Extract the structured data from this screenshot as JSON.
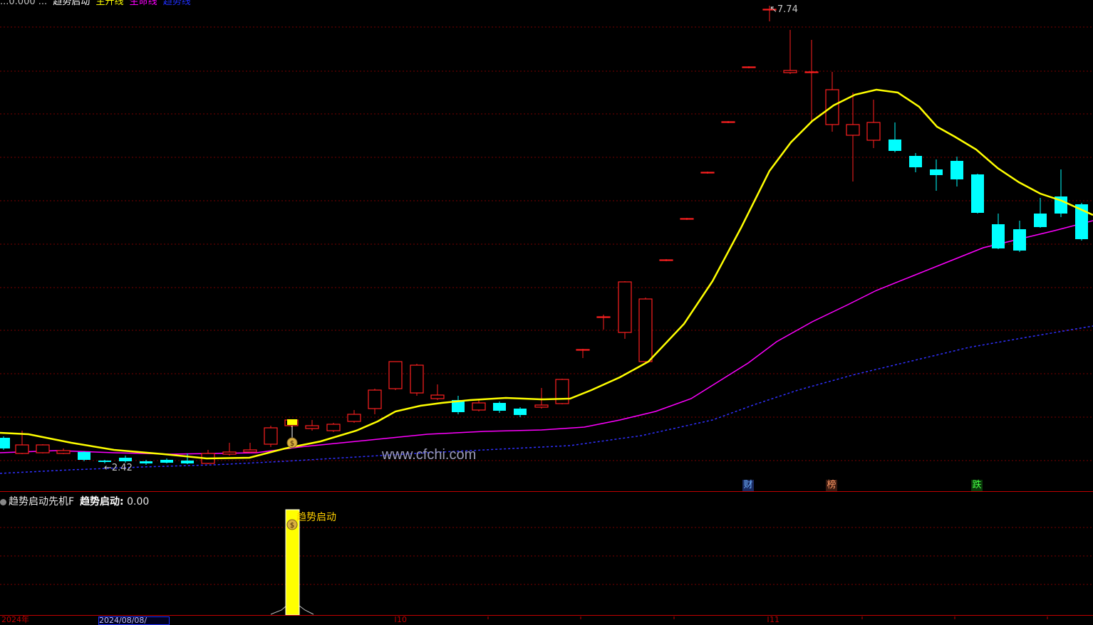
{
  "header": {
    "items": [
      {
        "text": "...0.000 ...",
        "color": "#c0c0c0"
      },
      {
        "text": "趋势启动",
        "color": "#ffffff"
      },
      {
        "text": "主升线",
        "color": "#ffff00"
      },
      {
        "text": "生命线",
        "color": "#ff00ff"
      },
      {
        "text": "趋势线",
        "color": "#2030ff"
      }
    ]
  },
  "main_chart": {
    "price_high_label": "7.74",
    "price_low_label": "2.42",
    "watermark": "www.cfchi.com",
    "badges": [
      {
        "text": "财",
        "color": "#6fb0ff",
        "bg": "#1a2a60"
      },
      {
        "text": "榜",
        "color": "#ff9966",
        "bg": "#3a1a10"
      },
      {
        "text": "跌",
        "color": "#44ff44",
        "bg": "#0a3a0a"
      }
    ],
    "colors": {
      "up_candle": "#ff2020",
      "down_candle": "#00ffff",
      "ma_yellow": "#ffff00",
      "ma_magenta": "#ff00ff",
      "ma_blue_dotted": "#3030ff",
      "grid": "#800000"
    }
  },
  "sub_chart": {
    "indicator_name": "趋势启动先机F",
    "indicator_label": "趋势启动:",
    "indicator_value": "0.00",
    "signal_text": "趋势启动",
    "signal_icon": "money-bag-icon"
  },
  "bottom_axis": {
    "year_label": "2024年",
    "date_box": "2024/08/08/",
    "month_labels": [
      "10",
      "11"
    ]
  }
}
